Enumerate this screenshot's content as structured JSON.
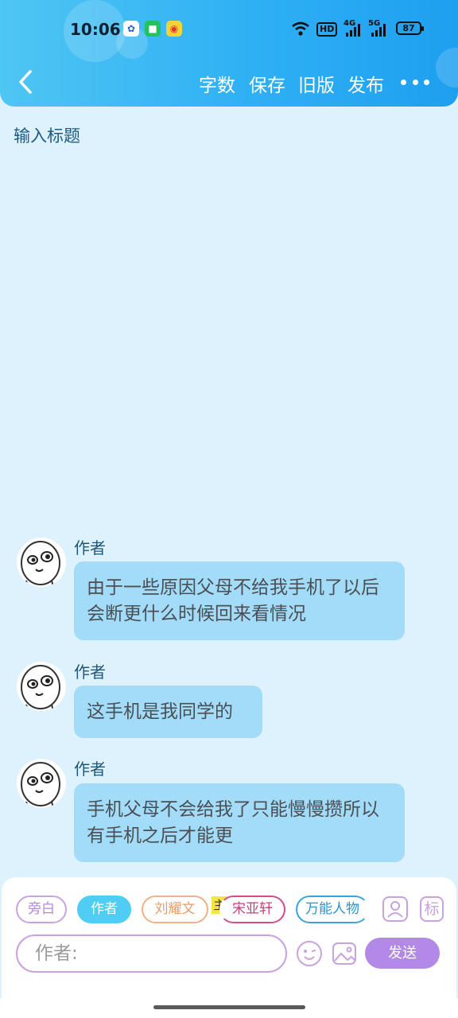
{
  "status_bar": {
    "time": "10:06",
    "network_label": "HD",
    "signal_1": "4G",
    "signal_2": "5G",
    "battery": "87"
  },
  "nav": {
    "word_count": "字数",
    "save": "保存",
    "old_version": "旧版",
    "publish": "发布"
  },
  "title_placeholder": "输入标题",
  "messages": [
    {
      "author": "作者",
      "text": "由于一些原因父母不给我手机了以后会断更什么时候回来看情况"
    },
    {
      "author": "作者",
      "text": "这手机是我同学的"
    },
    {
      "author": "作者",
      "text": "手机父母不会给我了只能慢慢攒所以有手机之后才能更"
    }
  ],
  "roles": {
    "narration": "旁白",
    "author": "作者",
    "char1": "刘耀文",
    "main_tag": "主",
    "char2": "宋亚轩",
    "universal": "万能人物"
  },
  "mark_button": "标",
  "input": {
    "placeholder": "作者:"
  },
  "send": "发送",
  "colors": {
    "header": "#2fb0f4",
    "bubble": "#a3dcf8",
    "send": "#b289e6",
    "author_chip": "#4fcdf2"
  }
}
